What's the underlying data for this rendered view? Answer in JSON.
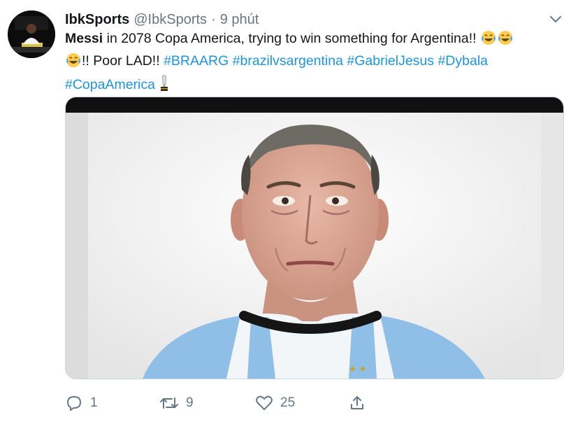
{
  "tweet": {
    "display_name": "IbkSports",
    "handle": "@IbkSports",
    "separator": "·",
    "time": "9 phút",
    "text": {
      "mention": "Messi",
      "body": " in 2078 Copa America, trying to win something for Argentina!! ",
      "body2": "!! Poor LAD!! ",
      "hashtags": [
        "#BRAARG",
        "#brazilvsargentina",
        "#GabrielJesus",
        "#Dybala",
        "#CopaAmerica"
      ]
    },
    "media_alt": "Aged face edit wearing Argentina jersey",
    "actions": {
      "reply_count": "1",
      "retweet_count": "9",
      "like_count": "25"
    },
    "icons": {
      "menu": "chevron-down-icon",
      "reply": "reply-icon",
      "retweet": "retweet-icon",
      "like": "heart-icon",
      "share": "share-icon",
      "emoji": "laughing-crying-emoji-icon",
      "trophy": "trophy-emoji-icon"
    },
    "colors": {
      "link": "#1b95e0",
      "secondary_text": "#657786",
      "border": "#ccd6dd",
      "jersey_blue": "#8fbfe6"
    }
  }
}
